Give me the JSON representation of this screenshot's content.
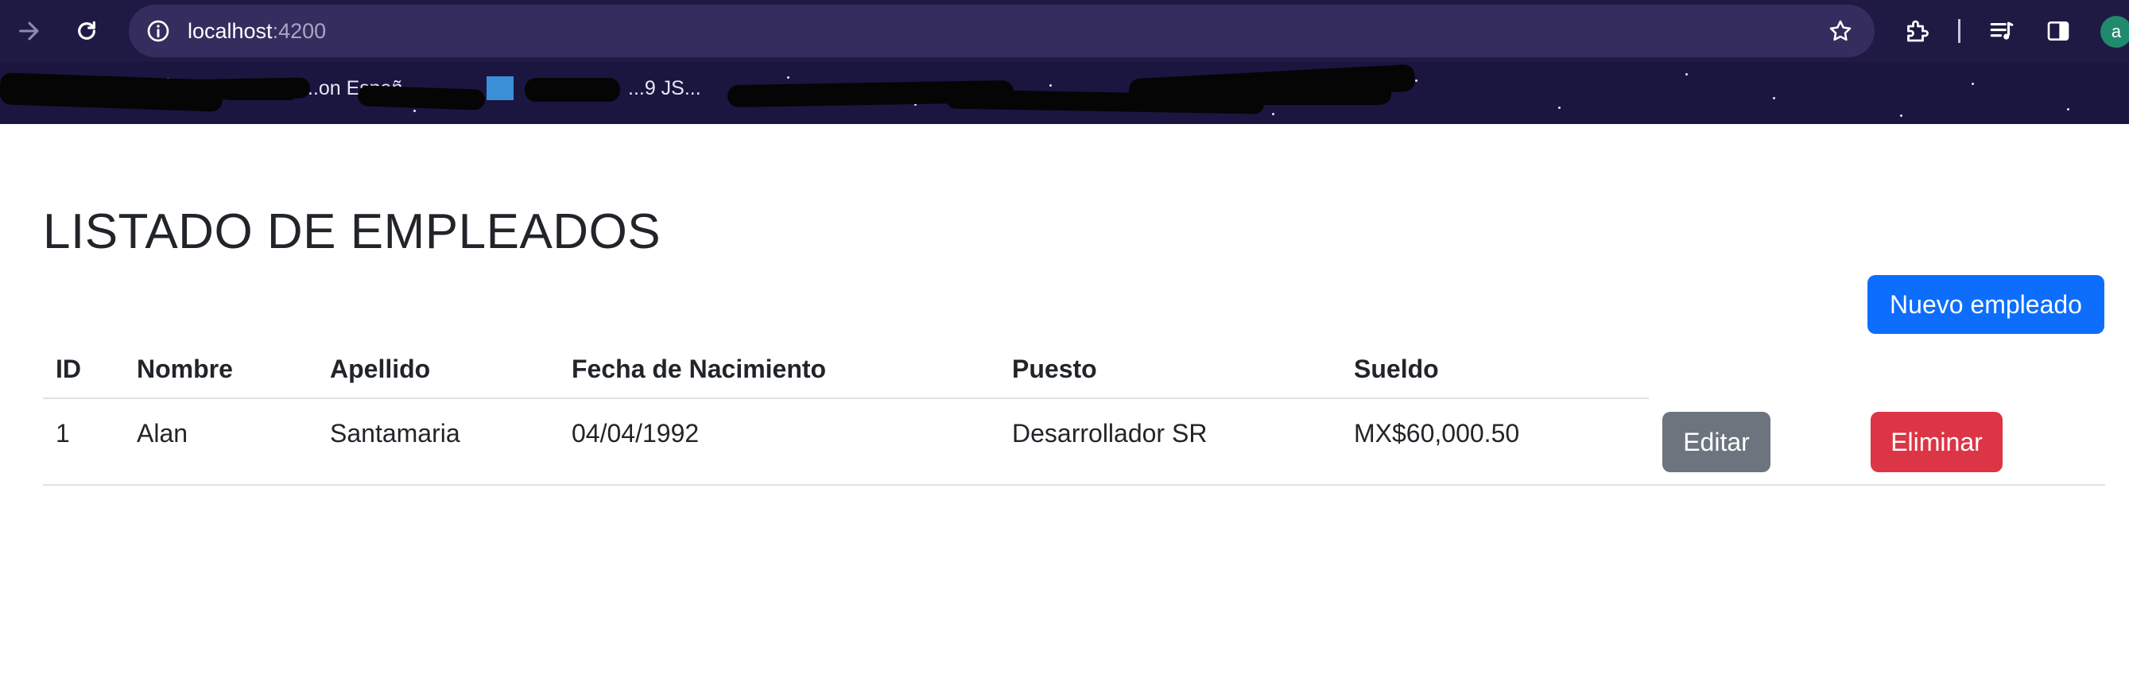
{
  "browser": {
    "url_host": "localhost",
    "url_port": ":4200",
    "profile_initial": "a",
    "bookmarks": [
      "...on Españ",
      "...9 JS..."
    ],
    "toolbar_bg": "#1f1a44",
    "bookmarks_bg": "#1a1640",
    "icons": [
      "forward-arrow-icon",
      "reload-icon",
      "site-info-icon",
      "bookmark-star-icon",
      "extensions-icon",
      "media-controls-icon",
      "side-panel-icon"
    ]
  },
  "page": {
    "title": "LISTADO DE EMPLEADOS",
    "new_button_label": "Nuevo empleado",
    "columns": [
      "ID",
      "Nombre",
      "Apellido",
      "Fecha de Nacimiento",
      "Puesto",
      "Sueldo"
    ],
    "rows": [
      {
        "id": "1",
        "nombre": "Alan",
        "apellido": "Santamaria",
        "fecha": "04/04/1992",
        "puesto": "Desarrollador SR",
        "sueldo": "MX$60,000.50",
        "edit_label": "Editar",
        "delete_label": "Eliminar"
      }
    ],
    "colors": {
      "primary": "#0d6efd",
      "secondary": "#6c757d",
      "danger": "#dc3545",
      "text": "#212529"
    }
  }
}
